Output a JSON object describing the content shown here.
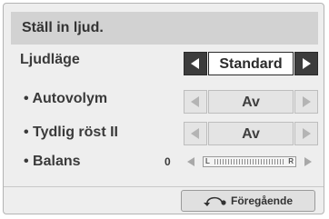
{
  "dialog": {
    "title": "Ställ in ljud."
  },
  "settings": {
    "sound_mode": {
      "label": "Ljudläge",
      "value": "Standard"
    },
    "auto_volume": {
      "label": "• Autovolym",
      "value": "Av"
    },
    "clear_voice": {
      "label": "• Tydlig röst II",
      "value": "Av"
    },
    "balance": {
      "label": "• Balans",
      "value": "0",
      "left_label": "L",
      "right_label": "R",
      "level": 0.5
    }
  },
  "footer": {
    "back_label": "Föregående"
  },
  "icons": {
    "left": "left-arrow-icon",
    "right": "right-arrow-icon",
    "back": "back-return-icon"
  },
  "colors": {
    "panel": "#eeeeee",
    "title_bar": "#d2d2d2",
    "active_arrow": "#3c3c3c"
  }
}
